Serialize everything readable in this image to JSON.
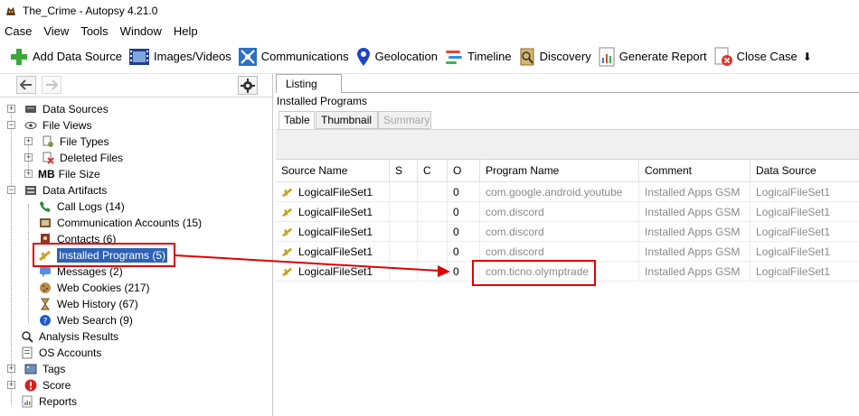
{
  "window": {
    "title": "The_Crime - Autopsy 4.21.0"
  },
  "menu": [
    "Case",
    "View",
    "Tools",
    "Window",
    "Help"
  ],
  "toolbar": {
    "add_data_source": "Add Data Source",
    "images_videos": "Images/Videos",
    "communications": "Communications",
    "geolocation": "Geolocation",
    "timeline": "Timeline",
    "discovery": "Discovery",
    "generate_report": "Generate Report",
    "close_case": "Close Case"
  },
  "tree": {
    "data_sources": "Data Sources",
    "file_views": "File Views",
    "file_types": "File Types",
    "deleted_files": "Deleted Files",
    "file_size": "File Size",
    "file_size_prefix": "MB",
    "data_artifacts": "Data Artifacts",
    "call_logs": "Call Logs (14)",
    "communication_accounts": "Communication Accounts (15)",
    "contacts": "Contacts (6)",
    "installed_programs": "Installed Programs (5)",
    "messages": "Messages (2)",
    "web_cookies": "Web Cookies (217)",
    "web_history": "Web History (67)",
    "web_search": "Web Search (9)",
    "analysis_results": "Analysis Results",
    "os_accounts": "OS Accounts",
    "tags": "Tags",
    "score": "Score",
    "reports": "Reports"
  },
  "viewer": {
    "tab": "Listing",
    "breadcrumb": "Installed Programs",
    "subtabs": [
      "Table",
      "Thumbnail",
      "Summary"
    ]
  },
  "table": {
    "headers": [
      "Source Name",
      "S",
      "C",
      "O",
      "Program Name",
      "Comment",
      "Data Source"
    ],
    "rows": [
      [
        "LogicalFileSet1",
        "",
        "",
        "0",
        "com.google.android.youtube",
        "Installed Apps GSM",
        "LogicalFileSet1"
      ],
      [
        "LogicalFileSet1",
        "",
        "",
        "0",
        "com.discord",
        "Installed Apps GSM",
        "LogicalFileSet1"
      ],
      [
        "LogicalFileSet1",
        "",
        "",
        "0",
        "com.discord",
        "Installed Apps GSM",
        "LogicalFileSet1"
      ],
      [
        "LogicalFileSet1",
        "",
        "",
        "0",
        "com.discord",
        "Installed Apps GSM",
        "LogicalFileSet1"
      ],
      [
        "LogicalFileSet1",
        "",
        "",
        "0",
        "com.ticno.olymptrade",
        "Installed Apps GSM",
        "LogicalFileSet1"
      ]
    ]
  },
  "colors": {
    "selection": "#2f62b5",
    "annotation": "#e00000"
  }
}
